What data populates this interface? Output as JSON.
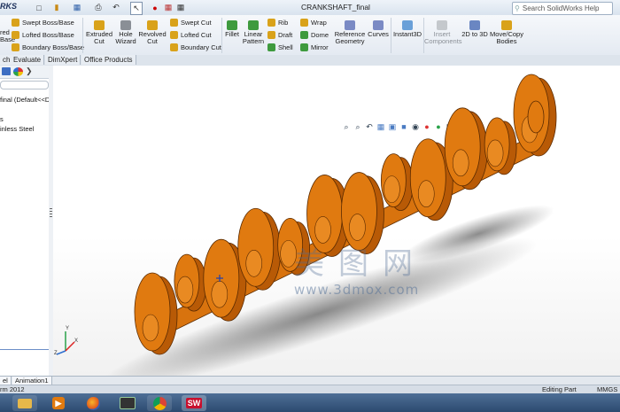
{
  "window": {
    "brand": "RKS",
    "document_title": "CRANKSHAFT_final",
    "help_placeholder": "Search SolidWorks Help"
  },
  "ribbon": {
    "boss_partial": [
      "red",
      "Base"
    ],
    "swept_boss": "Swept Boss/Base",
    "lofted_boss": "Lofted Boss/Base",
    "boundary_boss": "Boundary Boss/Base",
    "extruded_cut": [
      "Extruded",
      "Cut"
    ],
    "hole_wizard": [
      "Hole",
      "Wizard"
    ],
    "revolved_cut": [
      "Revolved",
      "Cut"
    ],
    "swept_cut": "Swept Cut",
    "lofted_cut": "Lofted Cut",
    "boundary_cut": "Boundary Cut",
    "fillet": "Fillet",
    "linear_pattern": [
      "Linear",
      "Pattern"
    ],
    "rib": "Rib",
    "draft": "Draft",
    "shell": "Shell",
    "wrap": "Wrap",
    "dome": "Dome",
    "mirror": "Mirror",
    "reference_geometry": [
      "Reference",
      "Geometry"
    ],
    "curves": "Curves",
    "instant3d": "Instant3D",
    "insert_components": [
      "Insert",
      "Components"
    ],
    "to_3d": "2D to 3D",
    "move_copy": [
      "Move/Copy",
      "Bodies"
    ]
  },
  "tabs": [
    "ch",
    "Evaluate",
    "DimXpert",
    "Office Products"
  ],
  "feature_tree": {
    "part_name": "final  (Default<<D",
    "item_s": "s",
    "material": "inless Steel"
  },
  "watermark": {
    "chinese": "美图网",
    "url": "www.3dmox.com"
  },
  "bottom_tabs": [
    "el",
    "Animation1"
  ],
  "status": {
    "version": "rm 2012",
    "mode": "Editing Part",
    "units": "MMGS"
  },
  "taskbar": {
    "sw_label": "SW"
  },
  "colors": {
    "part_orange": "#e07a10",
    "part_edge": "#5a2a00",
    "taskbar": "#2c4a70"
  }
}
